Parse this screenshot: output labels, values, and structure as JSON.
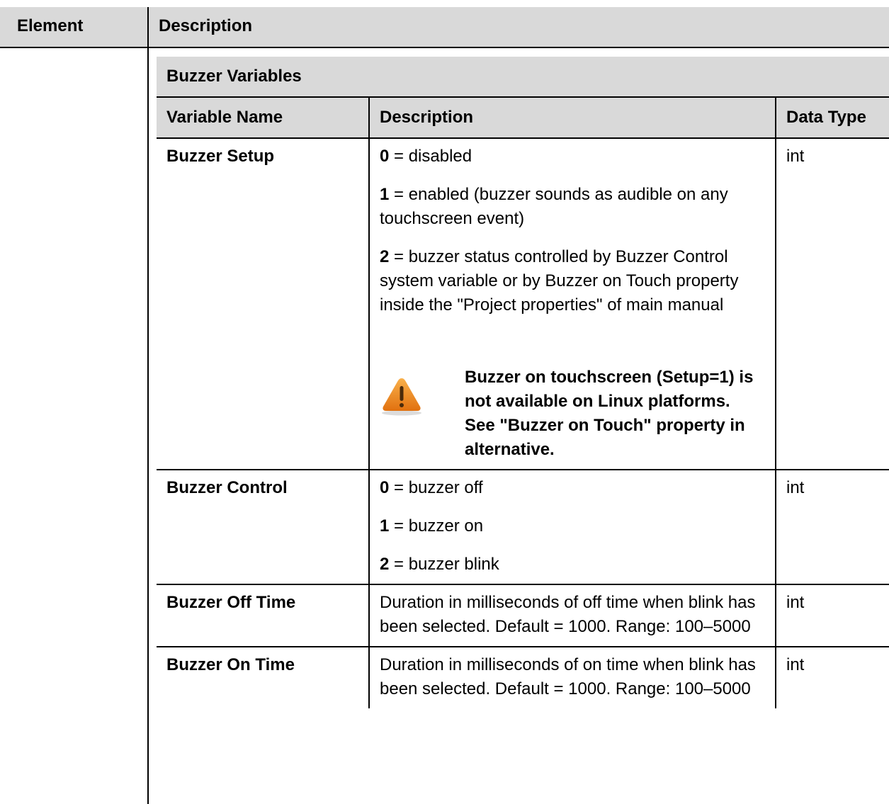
{
  "outer": {
    "col_element": "Element",
    "col_description": "Description"
  },
  "inner": {
    "caption": "Buzzer Variables",
    "headers": {
      "name": "Variable Name",
      "description": "Description",
      "type": "Data Type"
    },
    "rows": [
      {
        "name": "Buzzer Setup",
        "lines": [
          {
            "num": "0",
            "text": " = disabled"
          },
          {
            "num": "1",
            "text": " = enabled (buzzer sounds as audible on any touchscreen event)"
          },
          {
            "num": "2",
            "text": " = buzzer status controlled by Buzzer Control system variable or by Buzzer on Touch property inside the \"Project properties\" of main manual"
          }
        ],
        "warning": "Buzzer on touchscreen (Setup=1) is not available on Linux platforms. See \"Buzzer on Touch\" property in alternative.",
        "type": "int"
      },
      {
        "name": "Buzzer Control",
        "lines": [
          {
            "num": "0",
            "text": " = buzzer off"
          },
          {
            "num": "1",
            "text": " = buzzer on"
          },
          {
            "num": "2",
            "text": " = buzzer blink"
          }
        ],
        "type": "int"
      },
      {
        "name": "Buzzer Off Time",
        "description": "Duration in milliseconds of off time when blink has been selected. Default = 1000. Range: 100–5000",
        "type": "int"
      },
      {
        "name": "Buzzer On Time",
        "description": "Duration in milliseconds of on time when blink has been selected. Default = 1000. Range: 100–5000",
        "type": "int"
      }
    ]
  },
  "colors": {
    "header_bg": "#d9d9d9",
    "border": "#000000",
    "warning_icon": "#f08a1c"
  },
  "icons": {
    "warning": "warning-triangle-icon"
  }
}
